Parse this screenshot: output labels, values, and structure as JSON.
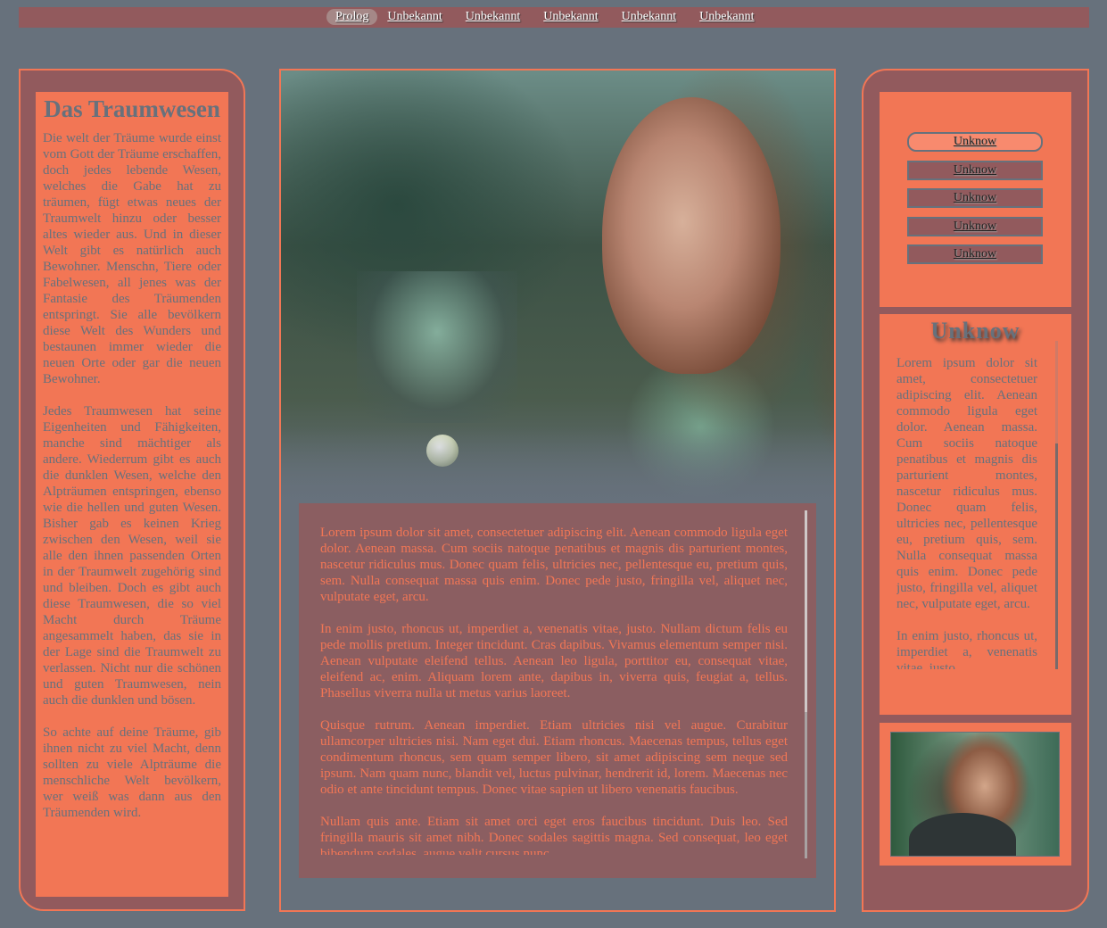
{
  "nav": {
    "items": [
      "Prolog",
      "Unbekannt",
      "Unbekannt",
      "Unbekannt",
      "Unbekannt",
      "Unbekannt"
    ]
  },
  "left": {
    "title": "Das Traumwesen",
    "paragraphs": [
      "Die welt der Träume wurde einst vom Gott der Träume erschaffen, doch jedes lebende Wesen, welches die Gabe hat zu träumen, fügt etwas neues der Traumwelt hinzu oder besser altes wieder aus. Und in dieser Welt gibt es natürlich auch Bewohner. Menschn, Tiere oder Fabelwesen, all jenes was der Fantasie des Träumenden entspringt. Sie alle bevölkern diese Welt des Wunders und bestaunen immer wieder die neuen Orte oder gar die neuen Bewohner.",
      "Jedes Traumwesen hat seine Eigenheiten und Fähigkeiten, manche sind mächtiger als andere. Wiederrum gibt es auch die dunklen Wesen, welche den Alpträumen entspringen, ebenso wie die hellen und guten Wesen. Bisher gab es keinen Krieg zwischen den Wesen, weil sie alle den ihnen passenden Orten in der Traumwelt zugehörig sind und bleiben. Doch es gibt auch diese Traumwesen, die so viel Macht durch Träume angesammelt haben, das sie in der Lage sind die Traumwelt zu verlassen. Nicht nur die schönen und guten Traumwesen, nein auch die dunklen und bösen.",
      "So achte auf deine Träume, gib ihnen nicht zu viel Macht, denn sollten zu viele Alpträume die menschliche Welt bevölkern, wer weiß was dann aus den Träumenden wird."
    ]
  },
  "center": {
    "paragraphs": [
      "Lorem ipsum dolor sit amet, consectetuer adipiscing elit. Aenean commodo ligula eget dolor. Aenean massa. Cum sociis natoque penatibus et magnis dis parturient montes, nascetur ridiculus mus. Donec quam felis, ultricies nec, pellentesque eu, pretium quis, sem. Nulla consequat massa quis enim. Donec pede justo, fringilla vel, aliquet nec, vulputate eget, arcu.",
      "In enim justo, rhoncus ut, imperdiet a, venenatis vitae, justo. Nullam dictum felis eu pede mollis pretium. Integer tincidunt. Cras dapibus. Vivamus elementum semper nisi. Aenean vulputate eleifend tellus. Aenean leo ligula, porttitor eu, consequat vitae, eleifend ac, enim. Aliquam lorem ante, dapibus in, viverra quis, feugiat a, tellus. Phasellus viverra nulla ut metus varius laoreet.",
      "Quisque rutrum. Aenean imperdiet. Etiam ultricies nisi vel augue. Curabitur ullamcorper ultricies nisi. Nam eget dui. Etiam rhoncus. Maecenas tempus, tellus eget condimentum rhoncus, sem quam semper libero, sit amet adipiscing sem neque sed ipsum. Nam quam nunc, blandit vel, luctus pulvinar, hendrerit id, lorem. Maecenas nec odio et ante tincidunt tempus. Donec vitae sapien ut libero venenatis faucibus.",
      "Nullam quis ante. Etiam sit amet orci eget eros faucibus tincidunt. Duis leo. Sed fringilla mauris sit amet nibh. Donec sodales sagittis magna. Sed consequat, leo eget bibendum sodales, augue velit cursus nunc."
    ]
  },
  "right": {
    "menu": [
      "Unknow",
      "Unknow",
      "Unknow",
      "Unknow",
      "Unknow"
    ],
    "title": "Unknow",
    "paragraphs": [
      "Lorem ipsum dolor sit amet, consectetuer adipiscing elit. Aenean commodo ligula eget dolor. Aenean massa. Cum sociis natoque penatibus et magnis dis parturient montes, nascetur ridiculus mus. Donec quam felis, ultricies nec, pellentesque eu, pretium quis, sem. Nulla consequat massa quis enim. Donec pede justo, fringilla vel, aliquet nec, vulputate eget, arcu.",
      "In enim justo, rhoncus ut, imperdiet a, venenatis vitae, justo."
    ]
  },
  "colors": {
    "background": "#67717c",
    "panel": "#925a5d",
    "accent": "#f27655"
  }
}
